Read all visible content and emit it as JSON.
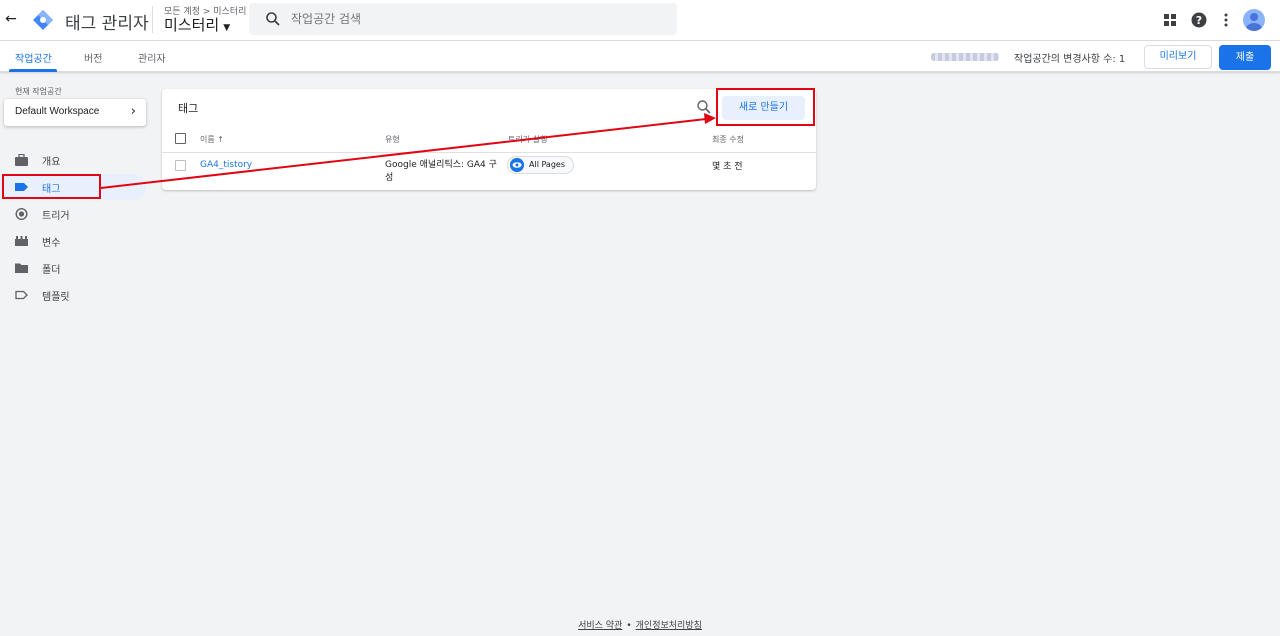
{
  "header": {
    "app_title": "태그 관리자",
    "breadcrumb": "모든 계정 > 미스터리",
    "container_name": "미스터리",
    "search_placeholder": "작업공간 검색"
  },
  "tabs": [
    {
      "label": "작업공간",
      "active": true
    },
    {
      "label": "버전",
      "active": false
    },
    {
      "label": "관리자",
      "active": false
    }
  ],
  "subbar": {
    "changes_text": "작업공간의 변경사항 수: 1",
    "preview_label": "미리보기",
    "submit_label": "제출"
  },
  "sidebar": {
    "workspace_label": "현재 작업공간",
    "workspace_name": "Default Workspace",
    "items": [
      {
        "label": "개요",
        "icon": "briefcase-icon"
      },
      {
        "label": "태그",
        "icon": "tag-icon",
        "active": true
      },
      {
        "label": "트리거",
        "icon": "trigger-icon"
      },
      {
        "label": "변수",
        "icon": "variable-icon"
      },
      {
        "label": "폴더",
        "icon": "folder-icon"
      },
      {
        "label": "템플릿",
        "icon": "template-icon"
      }
    ]
  },
  "tags_panel": {
    "title": "태그",
    "new_button": "새로 만들기",
    "columns": [
      "이름 ↑",
      "유형",
      "트리거 실행",
      "최종 수정"
    ],
    "rows": [
      {
        "name": "GA4_tistory",
        "type": "Google 애널리틱스: GA4 구성",
        "trigger": "All Pages",
        "last_edited": "몇 초 전"
      }
    ]
  },
  "footer": {
    "terms": "서비스 약관",
    "separator": "•",
    "privacy": "개인정보처리방침"
  },
  "colors": {
    "accent": "#1a73e8",
    "annotation": "#e10613"
  }
}
